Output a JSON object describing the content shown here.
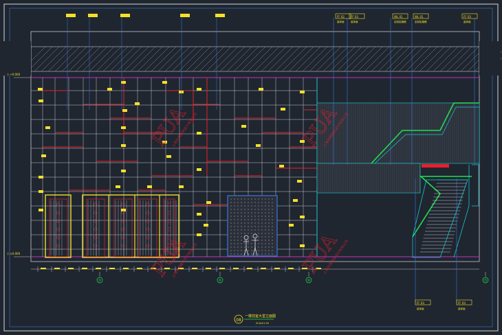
{
  "drawing": {
    "colors": {
      "background": "#1f2630",
      "frame": "#d9d9d9",
      "grid": "#c8c8d2",
      "red": "#e8202a",
      "magenta": "#c030c0",
      "cyan": "#19c8d0",
      "yellow": "#f5e028",
      "green": "#20e050",
      "blue": "#3a7ad8",
      "watermark": "#e8202a"
    },
    "level_marks": {
      "top": "▽ +0.000",
      "bottom": "▽ ±0.000"
    },
    "axis_markers": [
      "①",
      "⑤",
      "⑨",
      "⑬"
    ],
    "callouts_top": [
      {
        "code": "FF 02",
        "note": "装饰面"
      },
      {
        "code": "FF 03",
        "note": "装饰面"
      },
      {
        "code": "WL 01",
        "note": "定制铝格栅"
      },
      {
        "code": "WL 01",
        "note": "定制铝格栅"
      },
      {
        "code": "FF 03",
        "note": "装饰面"
      }
    ],
    "callouts_bottom": [
      {
        "code": "FF 03",
        "note": "装饰面"
      },
      {
        "code": "FF 03",
        "note": "装饰面"
      }
    ],
    "title_block": {
      "number": "08",
      "title": "一楼前室大堂立面图",
      "scale": "SCALE1:50"
    },
    "watermarks": [
      {
        "text": "PUA",
        "sub": "上海华源建筑设计有限公司"
      },
      {
        "text": "PUA",
        "sub": "上海华源建筑设计有限公司"
      },
      {
        "text": "PUA",
        "sub": "上海华源建筑设计有限公司"
      },
      {
        "text": "PUA",
        "sub": "上海华源建筑设计有限公司"
      }
    ]
  }
}
